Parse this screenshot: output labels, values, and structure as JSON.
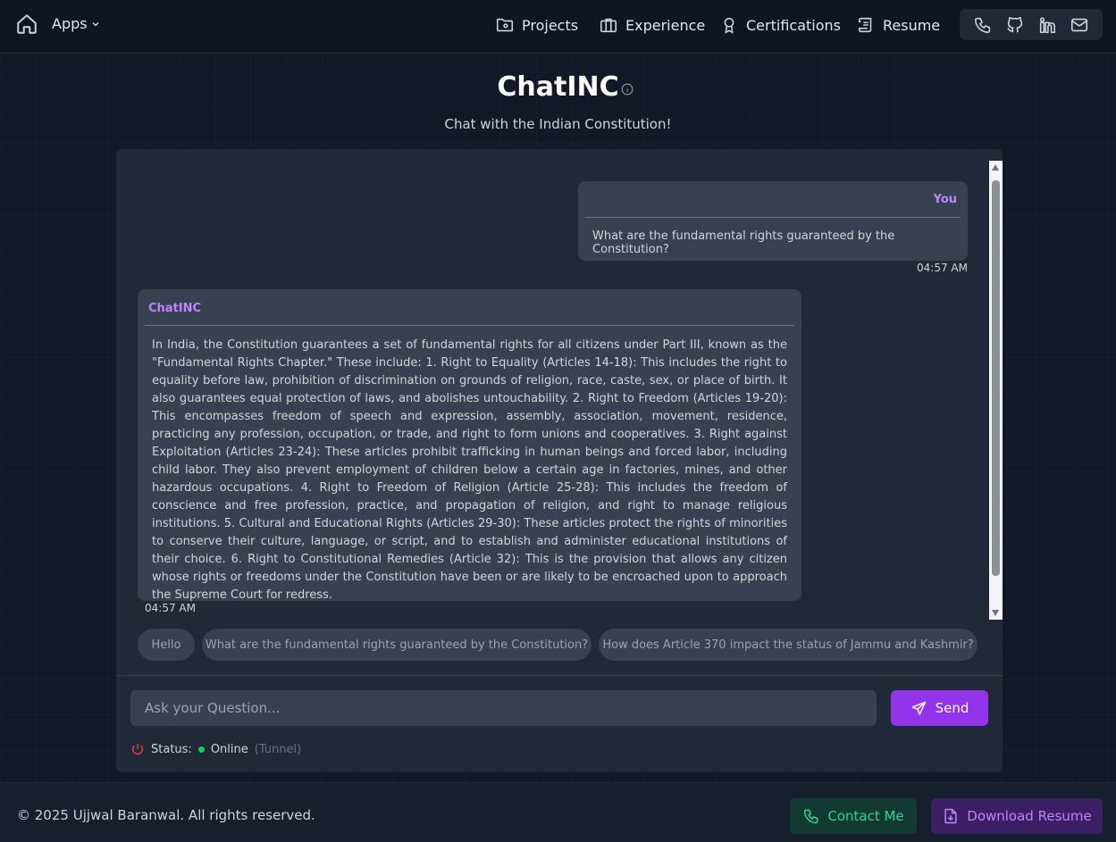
{
  "nav": {
    "home_icon": "home-icon",
    "apps_label": "Apps",
    "items": [
      {
        "label": "Projects",
        "icon": "folder-icon"
      },
      {
        "label": "Experience",
        "icon": "briefcase-icon"
      },
      {
        "label": "Certifications",
        "icon": "award-icon"
      },
      {
        "label": "Resume",
        "icon": "scroll-icon"
      }
    ],
    "social": [
      "phone-icon",
      "github-icon",
      "linkedin-icon",
      "mail-icon"
    ]
  },
  "header": {
    "title": "ChatINC",
    "subtitle": "Chat with the Indian Constitution!"
  },
  "chat": {
    "messages": [
      {
        "sender": "You",
        "text": "What are the fundamental rights guaranteed by the Constitution?",
        "time": "04:57 AM"
      },
      {
        "sender": "ChatINC",
        "text": "In India, the Constitution guarantees a set of fundamental rights for all citizens under Part III, known as the \"Fundamental Rights Chapter.\" These include: 1. Right to Equality (Articles 14-18): This includes the right to equality before law, prohibition of discrimination on grounds of religion, race, caste, sex, or place of birth. It also guarantees equal protection of laws, and abolishes untouchability. 2. Right to Freedom (Articles 19-20): This encompasses freedom of speech and expression, assembly, association, movement, residence, practicing any profession, occupation, or trade, and right to form unions and cooperatives. 3. Right against Exploitation (Articles 23-24): These articles prohibit trafficking in human beings and forced labor, including child labor. They also prevent employment of children below a certain age in factories, mines, and other hazardous occupations. 4. Right to Freedom of Religion (Article 25-28): This includes the freedom of conscience and free profession, practice, and propagation of religion, and right to manage religious institutions. 5. Cultural and Educational Rights (Articles 29-30): These articles protect the rights of minorities to conserve their culture, language, or script, and to establish and administer educational institutions of their choice. 6. Right to Constitutional Remedies (Article 32): This is the provision that allows any citizen whose rights or freedoms under the Constitution have been or are likely to be encroached upon to approach the Supreme Court for redress.",
        "time": "04:57 AM"
      }
    ],
    "suggestions": [
      "Hello",
      "What are the fundamental rights guaranteed by the Constitution?",
      "How does Article 370 impact the status of Jammu and Kashmir?"
    ],
    "input_placeholder": "Ask your Question...",
    "input_value": "",
    "send_label": "Send",
    "status_label": "Status:",
    "status_value": "Online",
    "status_mode": "(Tunnel)"
  },
  "footer": {
    "copyright": "© 2025 Ujjwal Baranwal. All rights reserved.",
    "contact_label": "Contact Me",
    "resume_label": "Download Resume"
  },
  "colors": {
    "background": "#111827",
    "panel": "#1f2937",
    "bubble": "#374151",
    "accent": "#9333ea",
    "sender": "#c084fc",
    "online": "#22c55e",
    "power": "#ef4444",
    "contact": "#34d399"
  }
}
